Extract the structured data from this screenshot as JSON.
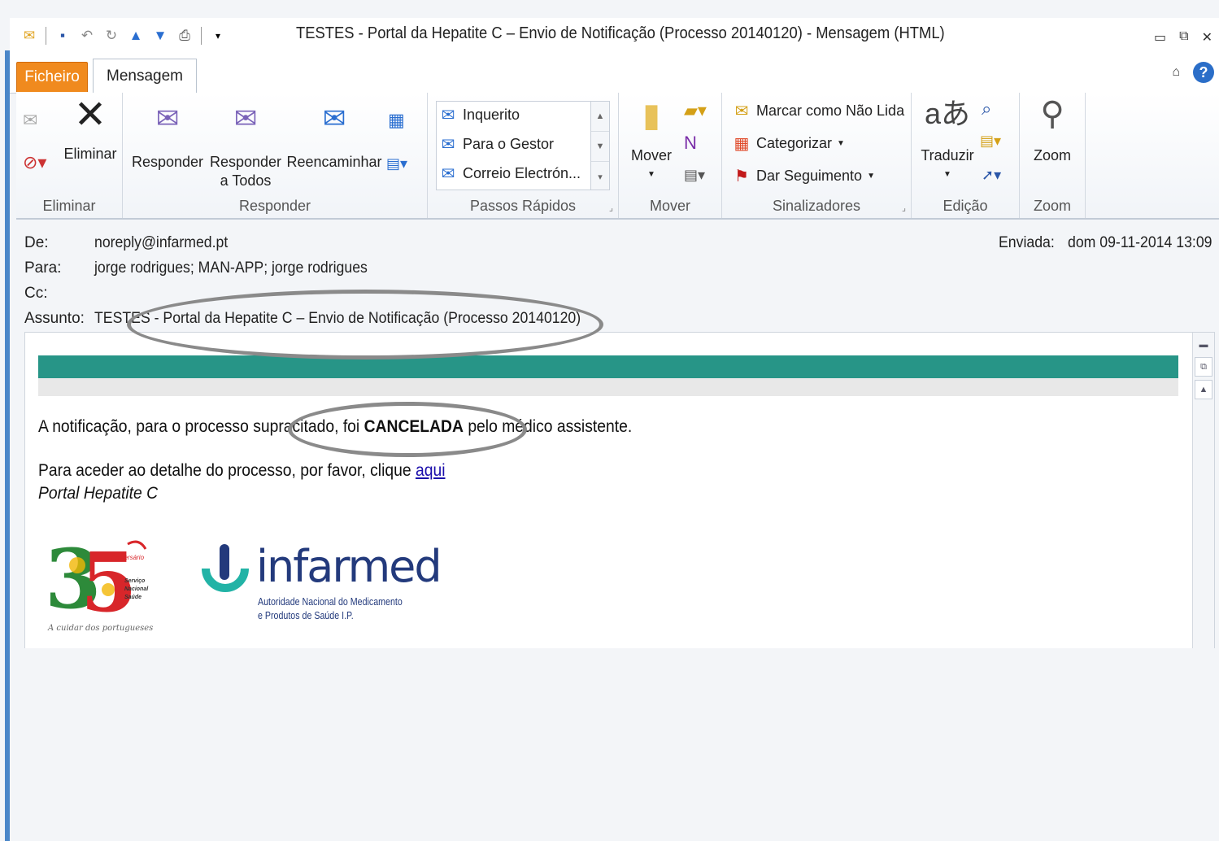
{
  "window": {
    "title": "TESTES - Portal da Hepatite C – Envio de Notificação (Processo 20140120)  -  Mensagem (HTML)"
  },
  "tabs": [
    {
      "label": "Ficheiro",
      "active": false
    },
    {
      "label": "Mensagem",
      "active": true
    }
  ],
  "ribbon": {
    "groups": {
      "eliminar": {
        "label": "Eliminar",
        "delete_label": "Eliminar"
      },
      "responder": {
        "label": "Responder",
        "reply": "Responder",
        "reply_all_1": "Responder",
        "reply_all_2": "a Todos",
        "forward": "Reencaminhar"
      },
      "passos": {
        "label": "Passos Rápidos",
        "items": [
          "Inquerito",
          "Para o Gestor",
          "Correio Electrón..."
        ]
      },
      "mover": {
        "label": "Mover",
        "move": "Mover"
      },
      "sinalizadores": {
        "label": "Sinalizadores",
        "mark_unread": "Marcar como Não Lida",
        "categorize": "Categorizar",
        "follow_up": "Dar Seguimento"
      },
      "edicao": {
        "label": "Edição",
        "translate": "Traduzir"
      },
      "zoom": {
        "label": "Zoom",
        "zoom": "Zoom"
      }
    }
  },
  "message": {
    "from_label": "De:",
    "from": "noreply@infarmed.pt",
    "to_label": "Para:",
    "to": "jorge rodrigues; MAN-APP; jorge rodrigues",
    "cc_label": "Cc:",
    "cc": "",
    "subject_label": "Assunto:",
    "subject": "TESTES - Portal da Hepatite C – Envio de Notificação (Processo 20140120)",
    "sent_label": "Enviada:",
    "sent": "dom 09-11-2014 13:09"
  },
  "body": {
    "line1_pre": "A notificação, para o processo supracitado, foi ",
    "line1_bold": "CANCELADA",
    "line1_post": " pelo médico assistente.",
    "line2_pre": "Para aceder ao detalhe do processo, por favor, clique ",
    "line2_link": "aqui",
    "signature": "Portal Hepatite C",
    "logo35_caption": "A cuidar dos portugueses",
    "logo35_tag": "Aniversário",
    "logo35_sns": [
      "Serviço",
      "Nacional",
      "Saúde"
    ],
    "logo_infarmed": "infarmed",
    "logo_infarmed_sub1": "Autoridade Nacional do Medicamento",
    "logo_infarmed_sub2": "e Produtos de Saúde I.P."
  },
  "colors": {
    "file_tab": "#f08a1e",
    "teal_band": "#279587",
    "link": "#1a0dab",
    "infarmed_blue": "#233a7c",
    "infarmed_teal": "#22b3a6"
  }
}
